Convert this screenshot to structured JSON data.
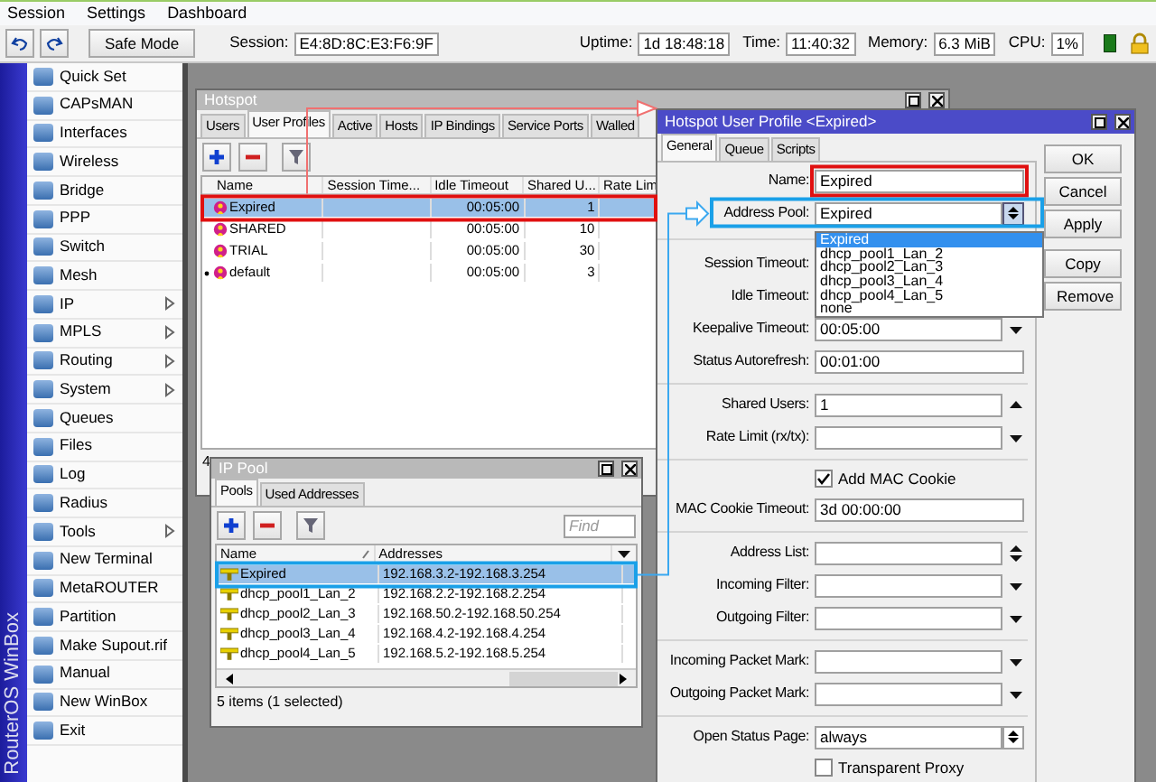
{
  "menubar": [
    "Session",
    "Settings",
    "Dashboard"
  ],
  "toolbar": {
    "safe_mode": "Safe Mode",
    "session_label": "Session:",
    "session_value": "E4:8D:8C:E3:F6:9F",
    "stats": [
      {
        "label": "Uptime:",
        "value": "1d 18:48:18"
      },
      {
        "label": "Time:",
        "value": "11:40:32"
      },
      {
        "label": "Memory:",
        "value": "6.3 MiB"
      },
      {
        "label": "CPU:",
        "value": "1%"
      }
    ]
  },
  "sidebar": {
    "brand": "RouterOS WinBox",
    "items": [
      {
        "label": "Quick Set",
        "submenu": false
      },
      {
        "label": "CAPsMAN",
        "submenu": false
      },
      {
        "label": "Interfaces",
        "submenu": false
      },
      {
        "label": "Wireless",
        "submenu": false
      },
      {
        "label": "Bridge",
        "submenu": false
      },
      {
        "label": "PPP",
        "submenu": false
      },
      {
        "label": "Switch",
        "submenu": false
      },
      {
        "label": "Mesh",
        "submenu": false
      },
      {
        "label": "IP",
        "submenu": true
      },
      {
        "label": "MPLS",
        "submenu": true
      },
      {
        "label": "Routing",
        "submenu": true
      },
      {
        "label": "System",
        "submenu": true
      },
      {
        "label": "Queues",
        "submenu": false
      },
      {
        "label": "Files",
        "submenu": false
      },
      {
        "label": "Log",
        "submenu": false
      },
      {
        "label": "Radius",
        "submenu": false
      },
      {
        "label": "Tools",
        "submenu": true
      },
      {
        "label": "New Terminal",
        "submenu": false
      },
      {
        "label": "MetaROUTER",
        "submenu": false
      },
      {
        "label": "Partition",
        "submenu": false
      },
      {
        "label": "Make Supout.rif",
        "submenu": false
      },
      {
        "label": "Manual",
        "submenu": false
      },
      {
        "label": "New WinBox",
        "submenu": false
      },
      {
        "label": "Exit",
        "submenu": false
      }
    ]
  },
  "hotspot_window": {
    "title": "Hotspot",
    "active": false,
    "tabs": [
      {
        "label": "Users",
        "selected": false
      },
      {
        "label": "User Profiles",
        "selected": true
      },
      {
        "label": "Active",
        "selected": false
      },
      {
        "label": "Hosts",
        "selected": false
      },
      {
        "label": "IP Bindings",
        "selected": false
      },
      {
        "label": "Service Ports",
        "selected": false
      },
      {
        "label": "Walled",
        "selected": false
      }
    ],
    "columns": [
      "Name",
      "Session Time...",
      "Idle Timeout",
      "Shared U...",
      "Rate Lim"
    ],
    "rows": [
      {
        "name": "Expired",
        "idle_timeout": "00:05:00",
        "shared_users": "1",
        "selected": true,
        "default": false
      },
      {
        "name": "SHARED",
        "idle_timeout": "00:05:00",
        "shared_users": "10",
        "selected": false,
        "default": false
      },
      {
        "name": "TRIAL",
        "idle_timeout": "00:05:00",
        "shared_users": "30",
        "selected": false,
        "default": false
      },
      {
        "name": "default",
        "idle_timeout": "00:05:00",
        "shared_users": "3",
        "selected": false,
        "default": true
      }
    ],
    "status": "4"
  },
  "ip_pool_window": {
    "title": "IP Pool",
    "active": false,
    "tabs": [
      {
        "label": "Pools",
        "selected": true
      },
      {
        "label": "Used Addresses",
        "selected": false
      }
    ],
    "find": {
      "placeholder": "Find"
    },
    "columns": [
      "Name",
      "Addresses"
    ],
    "rows": [
      {
        "name": "Expired",
        "addresses": "192.168.3.2-192.168.3.254",
        "selected": true
      },
      {
        "name": "dhcp_pool1_Lan_2",
        "addresses": "192.168.2.2-192.168.2.254",
        "selected": false
      },
      {
        "name": "dhcp_pool2_Lan_3",
        "addresses": "192.168.50.2-192.168.50.254",
        "selected": false
      },
      {
        "name": "dhcp_pool3_Lan_4",
        "addresses": "192.168.4.2-192.168.4.254",
        "selected": false
      },
      {
        "name": "dhcp_pool4_Lan_5",
        "addresses": "192.168.5.2-192.168.5.254",
        "selected": false
      }
    ],
    "status": "5 items (1 selected)"
  },
  "profile_window": {
    "title": "Hotspot User Profile <Expired>",
    "active": true,
    "tabs": [
      {
        "label": "General",
        "selected": true
      },
      {
        "label": "Queue",
        "selected": false
      },
      {
        "label": "Scripts",
        "selected": false
      }
    ],
    "buttons": [
      [
        "OK",
        "Cancel",
        "Apply"
      ],
      [
        "Copy",
        "Remove"
      ]
    ],
    "sections": [
      [
        {
          "kind": "text",
          "label": "Name:",
          "value": "Expired"
        },
        {
          "kind": "select",
          "label": "Address Pool:",
          "value": "Expired",
          "expanded": true,
          "options": [
            {
              "label": "Expired",
              "selected": true
            },
            {
              "label": "dhcp_pool1_Lan_2",
              "selected": false
            },
            {
              "label": "dhcp_pool2_Lan_3",
              "selected": false
            },
            {
              "label": "dhcp_pool3_Lan_4",
              "selected": false
            },
            {
              "label": "dhcp_pool4_Lan_5",
              "selected": false
            },
            {
              "label": "none",
              "selected": false
            }
          ]
        }
      ],
      [
        {
          "kind": "down",
          "label": "Session Timeout:"
        },
        {
          "kind": "down",
          "label": "Idle Timeout:"
        },
        {
          "kind": "down",
          "label": "Keepalive Timeout:",
          "value": "00:05:00"
        },
        {
          "kind": "text",
          "label": "Status Autorefresh:",
          "value": "00:01:00"
        }
      ],
      [
        {
          "kind": "up",
          "label": "Shared Users:",
          "value": "1"
        },
        {
          "kind": "down",
          "label": "Rate Limit (rx/tx):"
        }
      ],
      [
        {
          "kind": "check",
          "label": "Add MAC Cookie",
          "checked": true
        },
        {
          "kind": "text",
          "label": "MAC Cookie Timeout:",
          "value": "3d 00:00:00"
        }
      ],
      [
        {
          "kind": "updown",
          "label": "Address List:"
        },
        {
          "kind": "down",
          "label": "Incoming Filter:"
        },
        {
          "kind": "down",
          "label": "Outgoing Filter:"
        }
      ],
      [
        {
          "kind": "down",
          "label": "Incoming Packet Mark:"
        },
        {
          "kind": "down",
          "label": "Outgoing Packet Mark:"
        }
      ],
      [
        {
          "kind": "select",
          "label": "Open Status Page:",
          "value": "always",
          "expanded": false
        },
        {
          "kind": "check",
          "label": "Transparent Proxy",
          "checked": false
        }
      ]
    ]
  }
}
